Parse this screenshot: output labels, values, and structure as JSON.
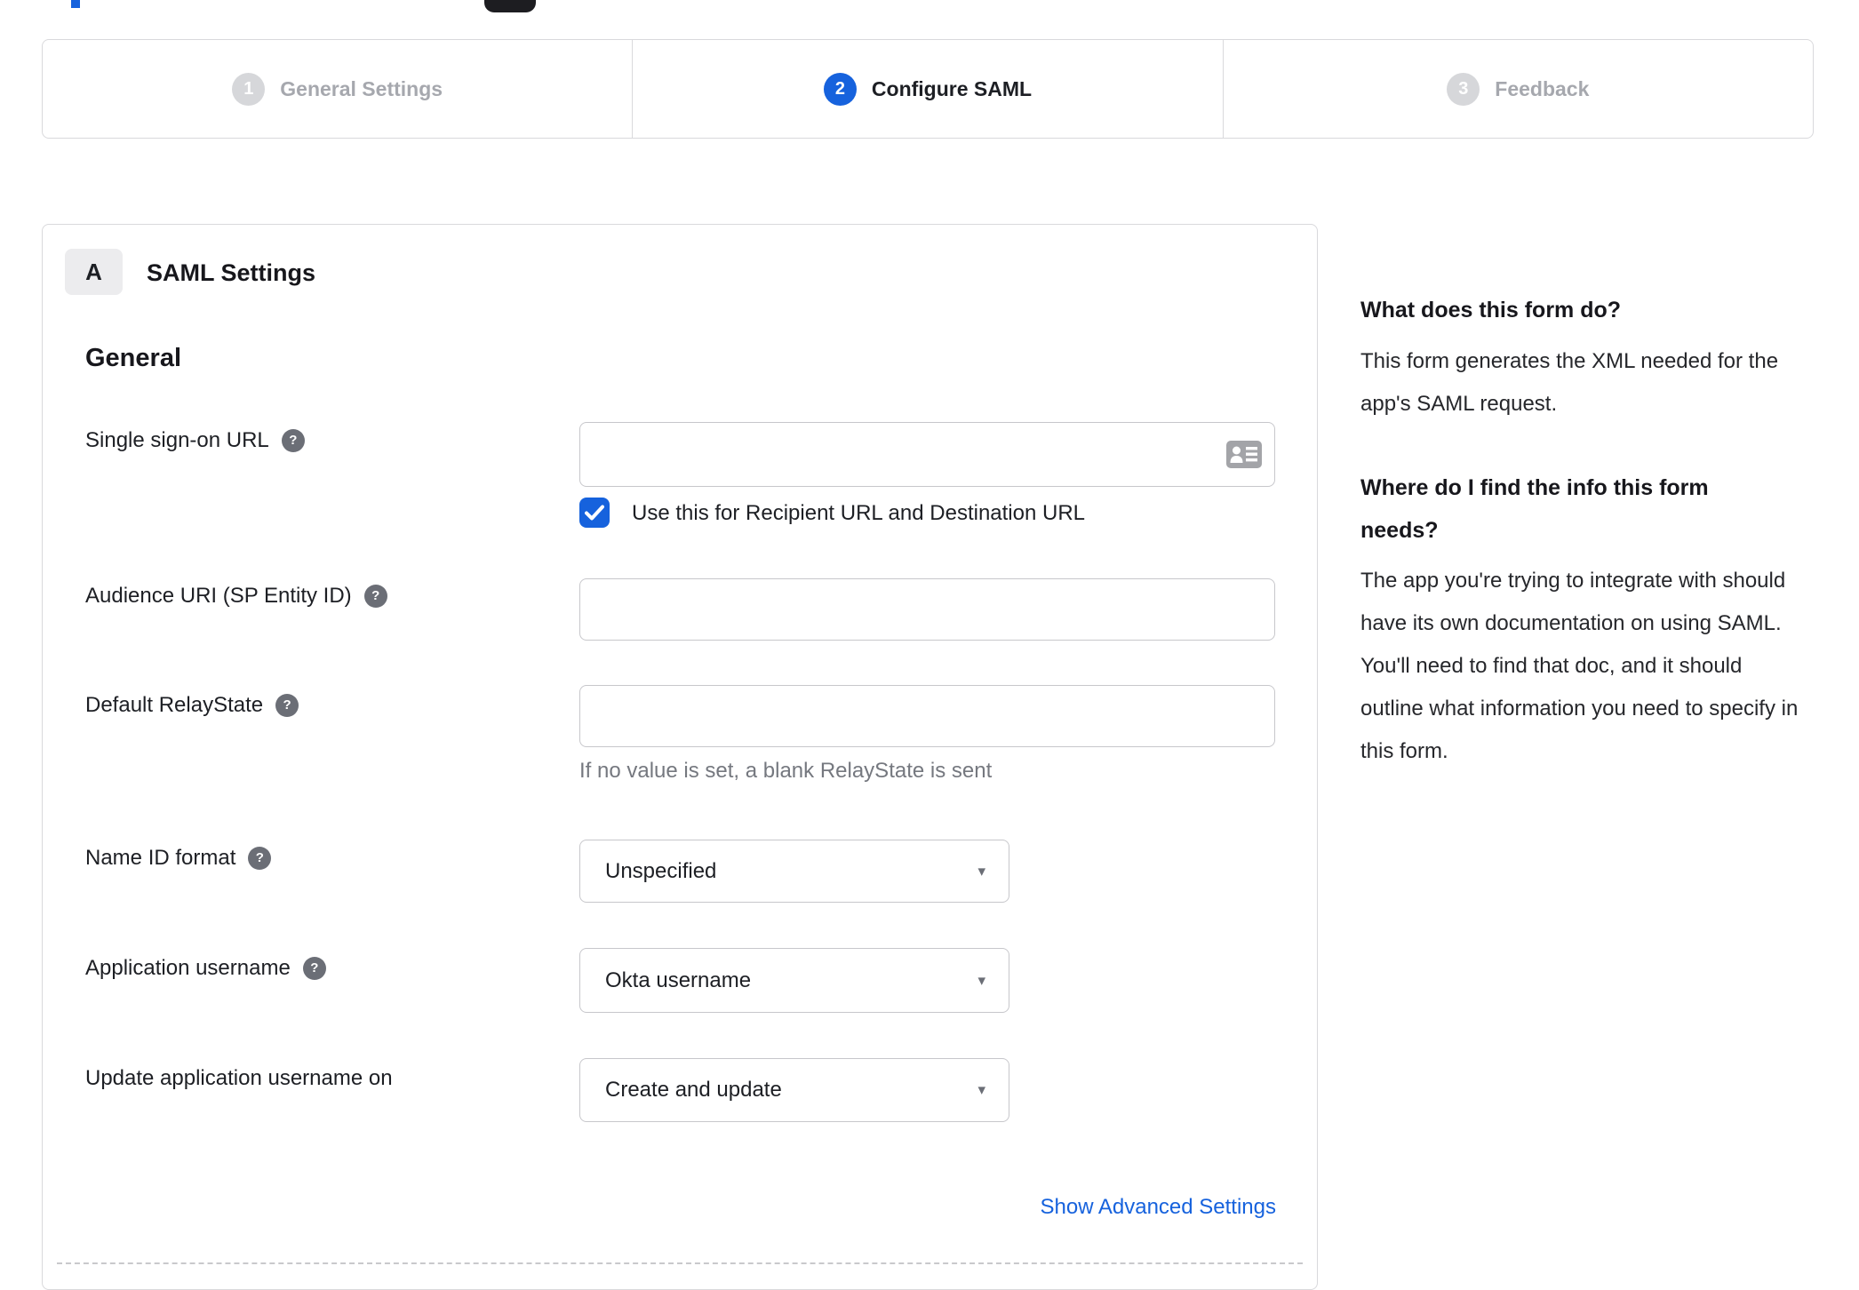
{
  "colors": {
    "accent": "#1662dd",
    "border": "#d9d9dc",
    "input_border": "#c7c7cb",
    "inactive_step": "#d6d7da",
    "hint_text": "#75787f"
  },
  "icons": {
    "help": "?",
    "caret": "▾"
  },
  "stepper": {
    "steps": [
      {
        "number": "1",
        "label": "General Settings",
        "state": "inactive"
      },
      {
        "number": "2",
        "label": "Configure SAML",
        "state": "active"
      },
      {
        "number": "3",
        "label": "Feedback",
        "state": "inactive"
      }
    ]
  },
  "form": {
    "section_badge": "A",
    "section_title": "SAML Settings",
    "group_title": "General",
    "fields": {
      "sso": {
        "label": "Single sign-on URL",
        "value": "",
        "checkbox_label": "Use this for Recipient URL and Destination URL",
        "checkbox_checked": true
      },
      "audience": {
        "label": "Audience URI (SP Entity ID)",
        "value": ""
      },
      "relay": {
        "label": "Default RelayState",
        "value": "",
        "hint": "If no value is set, a blank RelayState is sent"
      },
      "name_id": {
        "label": "Name ID format",
        "value": "Unspecified"
      },
      "app_username": {
        "label": "Application username",
        "value": "Okta username"
      },
      "update_username": {
        "label": "Update application username on",
        "value": "Create and update"
      }
    },
    "advanced_link": "Show Advanced Settings"
  },
  "sidebar": {
    "q1_title": "What does this form do?",
    "q1_body": "This form generates the XML needed for the app's SAML request.",
    "q2_title": "Where do I find the info this form needs?",
    "q2_body": "The app you're trying to integrate with should have its own documentation on using SAML. You'll need to find that doc, and it should outline what information you need to specify in this form."
  }
}
